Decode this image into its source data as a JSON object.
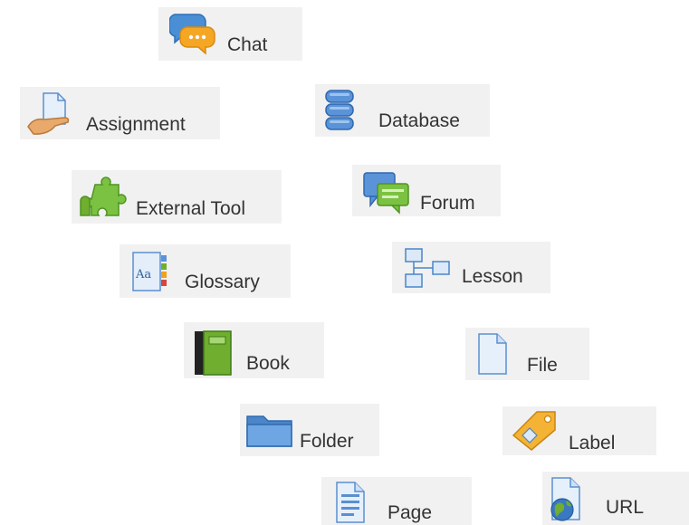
{
  "activities": [
    {
      "label": "Chat",
      "icon": "chat-icon"
    },
    {
      "label": "Assignment",
      "icon": "assignment-icon"
    },
    {
      "label": "Database",
      "icon": "database-icon"
    },
    {
      "label": "External Tool",
      "icon": "puzzle-piece-icon"
    },
    {
      "label": "Forum",
      "icon": "forum-icon"
    },
    {
      "label": "Glossary",
      "icon": "glossary-icon"
    },
    {
      "label": "Lesson",
      "icon": "lesson-icon"
    },
    {
      "label": "Book",
      "icon": "book-icon"
    },
    {
      "label": "File",
      "icon": "file-icon"
    },
    {
      "label": "Folder",
      "icon": "folder-icon"
    },
    {
      "label": "Label",
      "icon": "tag-icon"
    },
    {
      "label": "Page",
      "icon": "page-icon"
    },
    {
      "label": "URL",
      "icon": "url-globe-icon"
    }
  ],
  "colors": {
    "tile_background": "#f1f1f1",
    "label_text": "#333333",
    "blue_accent": "#4a86c8",
    "green_accent": "#6fae2e",
    "orange_accent": "#f0a21e"
  }
}
